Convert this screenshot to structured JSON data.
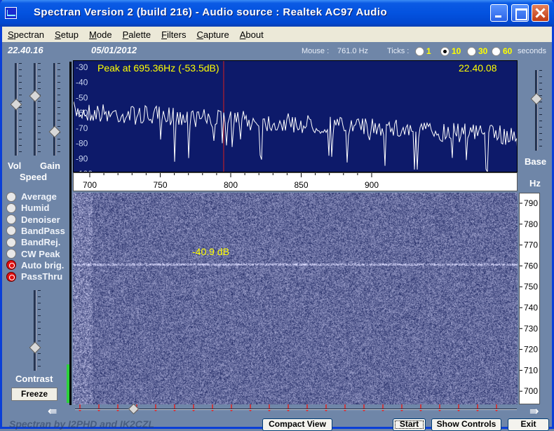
{
  "window": {
    "title": "Spectran Version 2 (build 216) - Audio source  :  Realtek AC97 Audio"
  },
  "menu": [
    "Spectran",
    "Setup",
    "Mode",
    "Palette",
    "Filters",
    "Capture",
    "About"
  ],
  "header": {
    "time": "22.40.16",
    "date": "05/01/2012",
    "mouse_label": "Mouse :",
    "mouse_value": "761.0 Hz",
    "ticks_label": "Ticks :",
    "tick_options": [
      {
        "label": "1",
        "selected": false
      },
      {
        "label": "10",
        "selected": true
      },
      {
        "label": "30",
        "selected": false
      },
      {
        "label": "60",
        "selected": false
      }
    ],
    "seconds_label": "seconds"
  },
  "left_panel": {
    "vol_label": "Vol",
    "gain_label": "Gain",
    "speed_label": "Speed",
    "contrast_label": "Contrast",
    "freeze_label": "Freeze",
    "options": [
      {
        "label": "Average",
        "active": false
      },
      {
        "label": "Humid",
        "active": false
      },
      {
        "label": "Denoiser",
        "active": false
      },
      {
        "label": "BandPass",
        "active": false
      },
      {
        "label": "BandRej.",
        "active": false
      },
      {
        "label": "CW Peak",
        "active": false
      },
      {
        "label": "Auto brig.",
        "active": true
      },
      {
        "label": "PassThru",
        "active": true
      }
    ],
    "slider_levels": {
      "vol": 0.45,
      "gain": 0.78,
      "speed": 0.35,
      "contrast": 0.75
    }
  },
  "right_panel": {
    "base_label": "Base",
    "hz_label": "Hz",
    "base_level": 0.35
  },
  "spectrum": {
    "peak_text": "Peak at  695.36Hz (-53.5dB)",
    "time_text": "22.40.08",
    "db_ticks": [
      "-30",
      "-40",
      "-50",
      "-60",
      "-70",
      "-80",
      "-90",
      "-100"
    ],
    "freq_ticks": [
      "700",
      "750",
      "800",
      "850",
      "900"
    ],
    "cursor_hz": 795
  },
  "waterfall": {
    "signal_label": "-40.9 dB",
    "freq_ticks": [
      "790",
      "780",
      "770",
      "760",
      "750",
      "740",
      "730",
      "720",
      "710",
      "700"
    ]
  },
  "bottom": {
    "buttons": [
      "Compact View",
      "Start",
      "Show Controls",
      "Exit"
    ],
    "status": "Spectran  by I2PHD and IK2CZL"
  },
  "colors": {
    "title_blue": "#0352df",
    "panel_bg": "#6f86a8",
    "spectrum_bg": "#0d1a6a",
    "peak_text": "#ffff00",
    "cursor": "#d22020"
  }
}
